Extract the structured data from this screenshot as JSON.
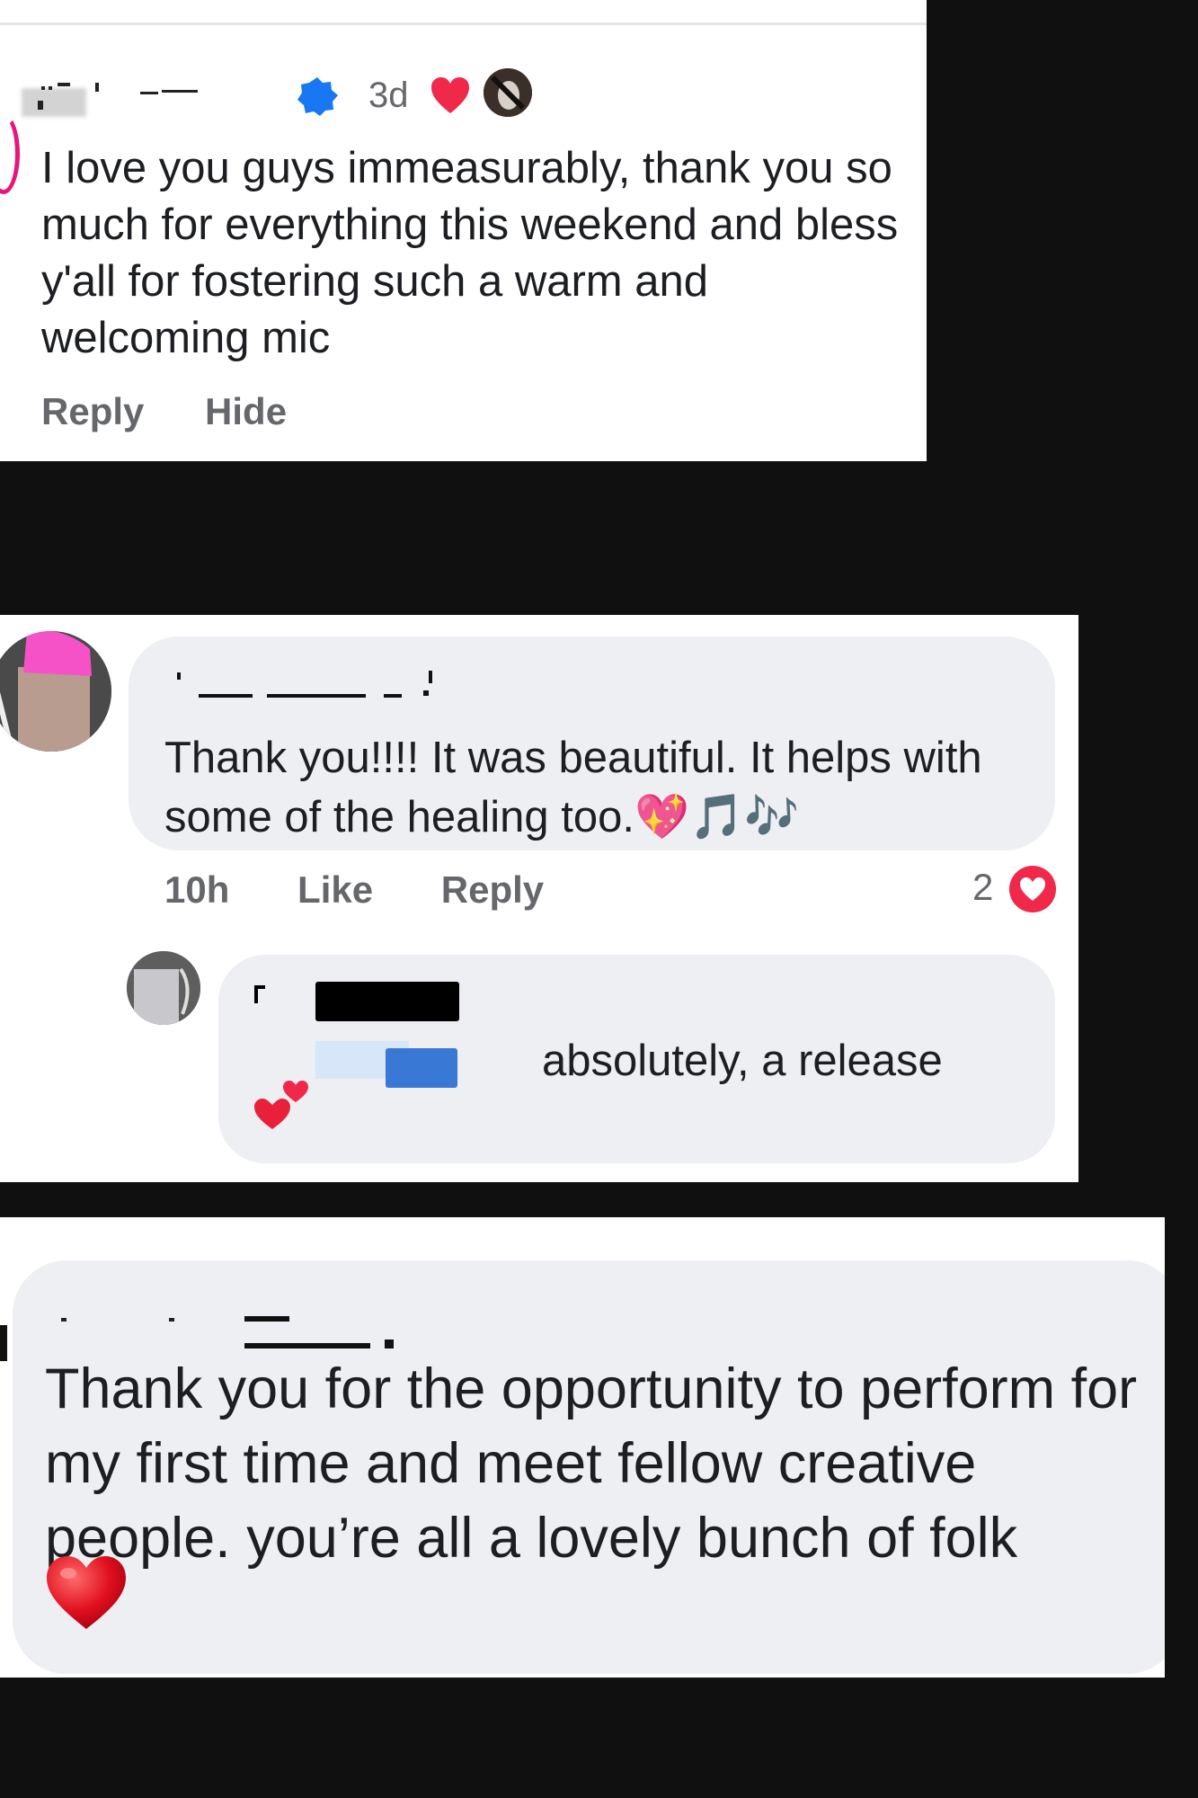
{
  "comment1": {
    "time": "3d",
    "text": "I love you guys immeasurably, thank you so much for everything this weekend and bless y'all for fostering such a warm and welcoming mic",
    "actions": {
      "reply": "Reply",
      "hide": "Hide"
    }
  },
  "comment2": {
    "text": "Thank you!!!! It was beautiful.  It helps with some of the healing too.💖🎵🎶",
    "actions": {
      "time": "10h",
      "like": "Like",
      "reply": "Reply"
    },
    "reaction_count": "2",
    "reply": {
      "text": "absolutely,  a release"
    }
  },
  "comment3": {
    "text": "Thank you for the opportunity to perform for my first time and meet fellow creative people. you’re all a lovely bunch of folk"
  },
  "colors": {
    "background": "#101010",
    "bubble": "#eeeff3",
    "muted_text": "#65676b",
    "heart": "#f02849",
    "verified_badge": "#1877f2"
  },
  "icons": [
    "verified-badge-icon",
    "heart-icon",
    "love-reaction-icon",
    "two-hearts-icon",
    "red-heart-emoji-icon"
  ]
}
